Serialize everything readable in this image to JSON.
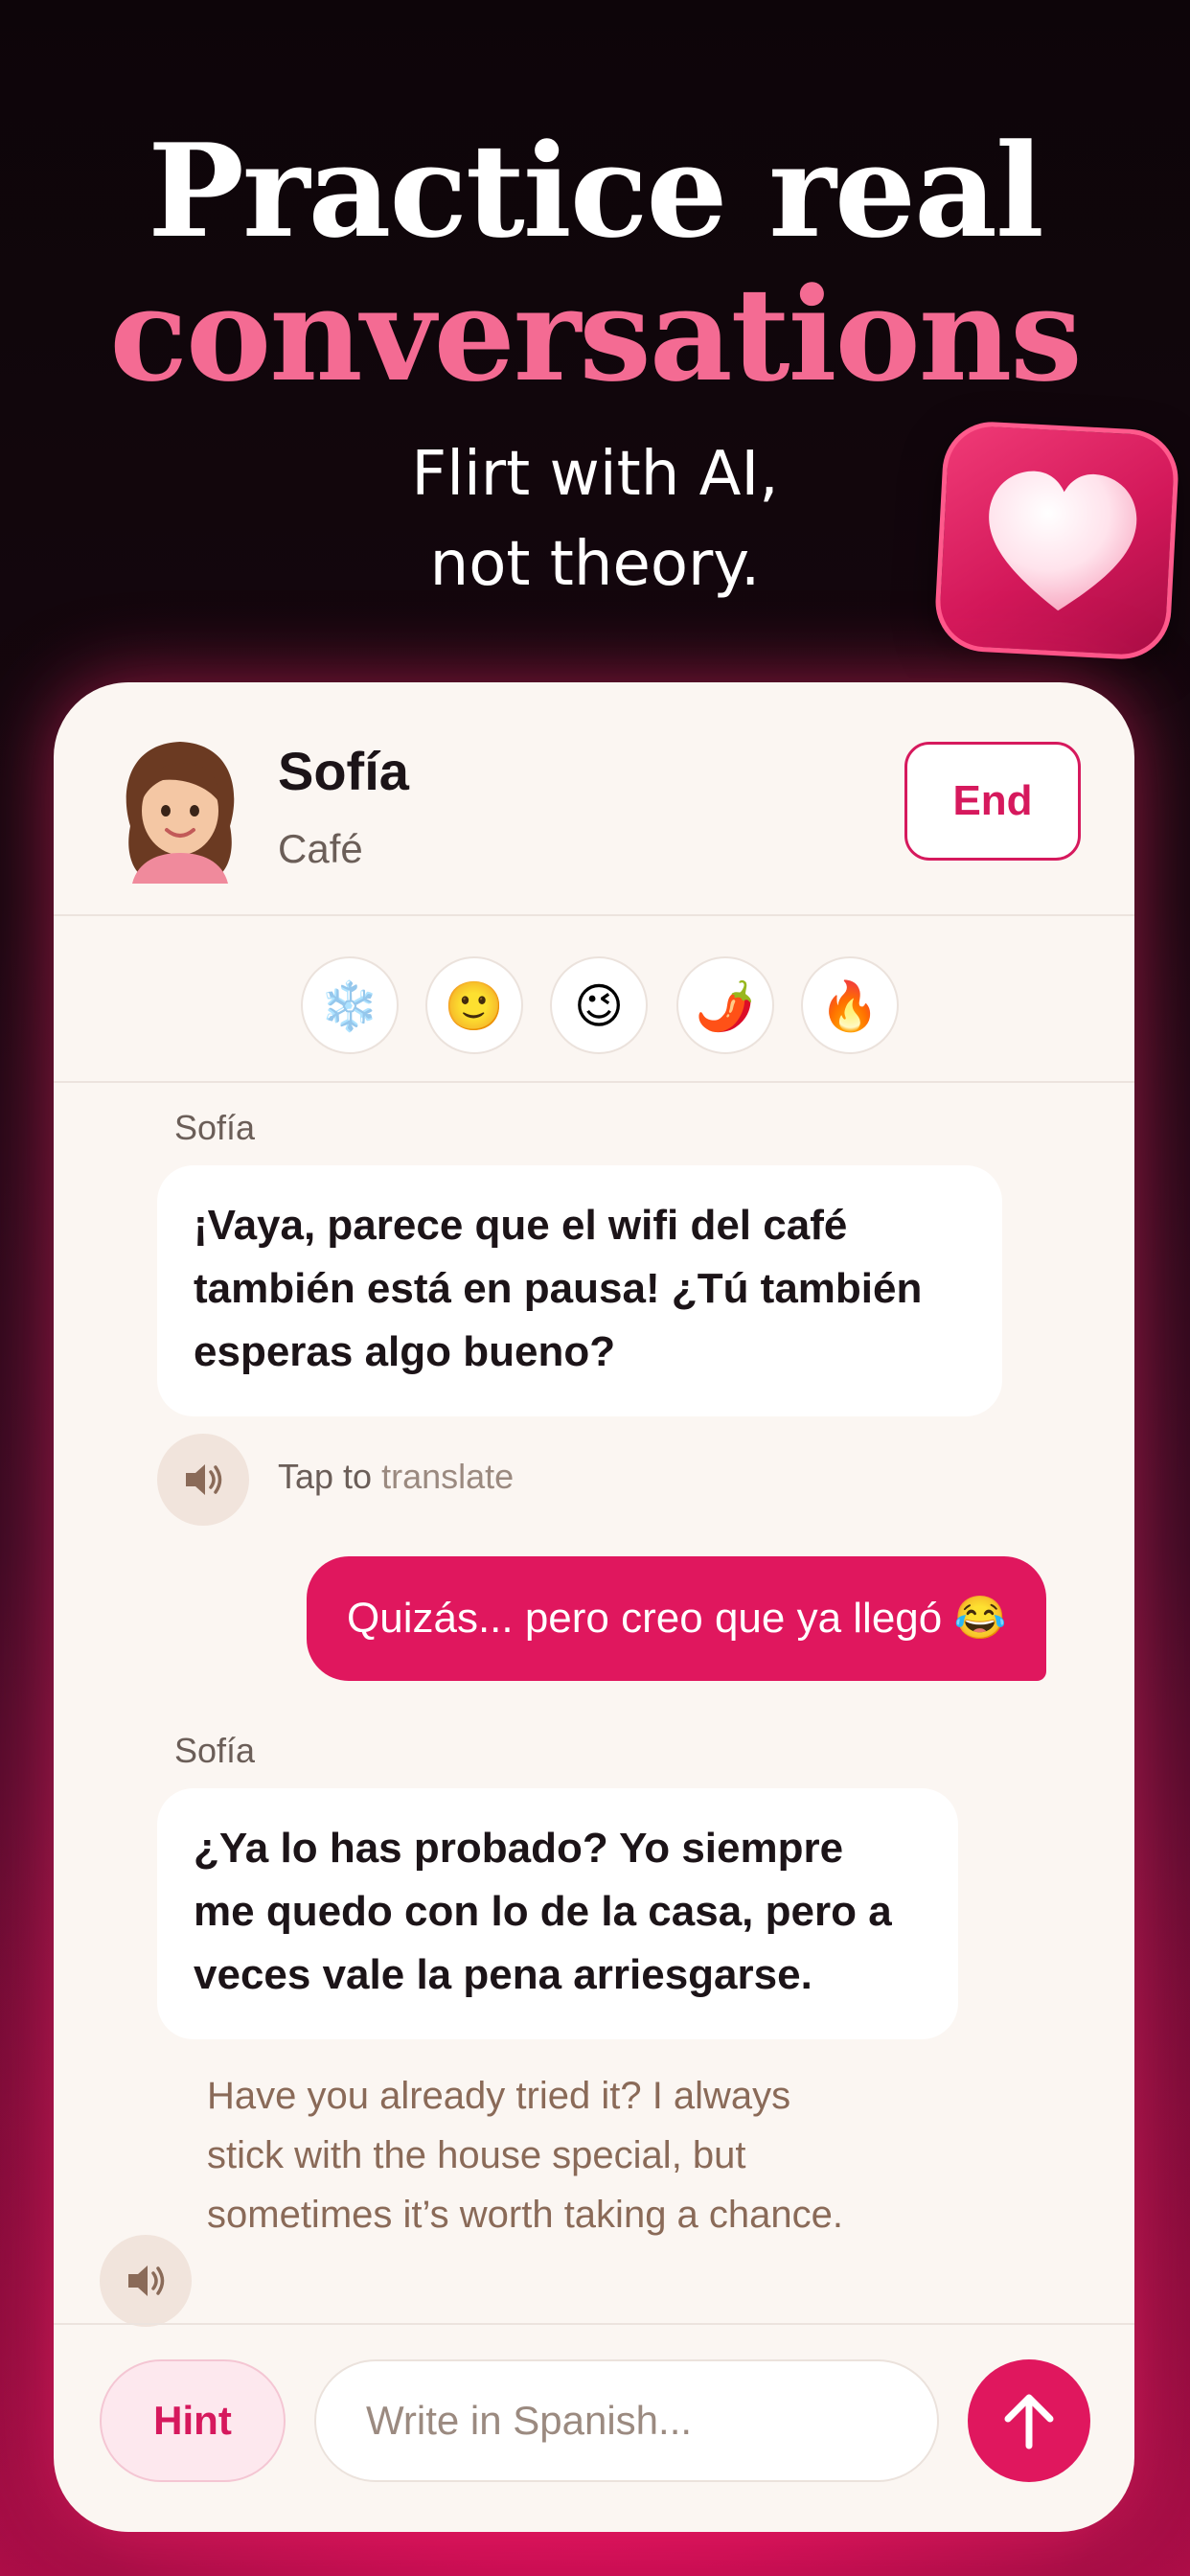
{
  "hero": {
    "line1": "Practice real",
    "line2": "conversations",
    "sub1": "Flirt with AI,",
    "sub2": "not theory."
  },
  "chat_header": {
    "name": "Sofía",
    "place": "Café",
    "end_label": "End"
  },
  "moods": [
    {
      "icon": "snowflake-icon",
      "glyph": "❄️"
    },
    {
      "icon": "smile-icon",
      "glyph": "🙂"
    },
    {
      "icon": "wink-icon",
      "glyph": "😉"
    },
    {
      "icon": "chili-icon",
      "glyph": "🌶️"
    },
    {
      "icon": "fire-icon",
      "glyph": "🔥"
    }
  ],
  "messages": {
    "m1_sender": "Sofía",
    "m1_line1": "¡Vaya, parece que el wifi del café",
    "m1_line2": "también está en pausa! ¿Tú también",
    "m1_line3": "esperas algo bueno?",
    "tap_prefix": "Tap to",
    "tap_word": "translate",
    "m2_text": "Quizás... pero creo que ya llegó 😂",
    "m3_sender": "Sofía",
    "m3_line1": "¿Ya lo has probado? Yo siempre",
    "m3_line2": "me quedo con lo de la casa, pero a",
    "m3_line3": "veces vale la pena arriesgarse.",
    "tr_line1": "Have you already tried it? I always",
    "tr_line2": "stick with the house special, but",
    "tr_line3": "sometimes it’s worth taking a chance."
  },
  "composer": {
    "hint_label": "Hint",
    "placeholder": "Write in Spanish..."
  },
  "colors": {
    "accent": "#e0175e",
    "pink_headline": "#f46b93",
    "card_bg": "#fbf6f2"
  }
}
